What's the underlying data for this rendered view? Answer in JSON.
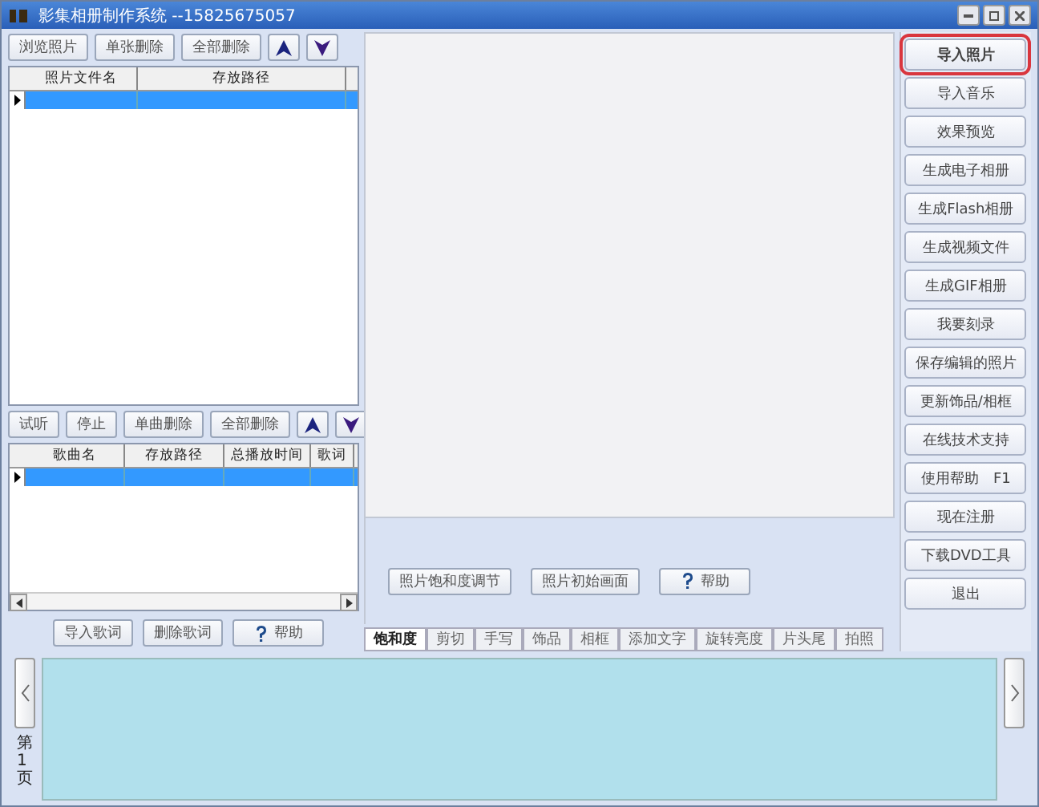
{
  "window": {
    "title": "影集相册制作系统 --15825675057"
  },
  "photo_toolbar": {
    "buttons": [
      "浏览照片",
      "单张删除",
      "全部删除"
    ]
  },
  "photo_table": {
    "columns": [
      "照片文件名",
      "存放路径"
    ],
    "rows": [
      {
        "selected": true
      }
    ]
  },
  "music_toolbar": {
    "buttons": [
      "试听",
      "停止",
      "单曲删除",
      "全部删除"
    ]
  },
  "music_table": {
    "columns": [
      "歌曲名",
      "存放路径",
      "总播放时间",
      "歌词"
    ],
    "rows": [
      {
        "selected": true
      }
    ]
  },
  "lyrics_buttons": [
    {
      "label": "导入歌词",
      "kind": "plain"
    },
    {
      "label": "删除歌词",
      "kind": "plain"
    },
    {
      "label": "帮助",
      "kind": "help"
    }
  ],
  "edit_buttons": [
    {
      "label": "照片饱和度调节",
      "kind": "plain"
    },
    {
      "label": "照片初始画面",
      "kind": "plain"
    },
    {
      "label": "帮助",
      "kind": "help"
    }
  ],
  "edit_tabs": [
    {
      "label": "饱和度",
      "selected": true
    },
    {
      "label": "剪切",
      "selected": false
    },
    {
      "label": "手写",
      "selected": false
    },
    {
      "label": "饰品",
      "selected": false
    },
    {
      "label": "相框",
      "selected": false
    },
    {
      "label": "添加文字",
      "selected": false
    },
    {
      "label": "旋转亮度",
      "selected": false
    },
    {
      "label": "片头尾",
      "selected": false
    },
    {
      "label": "拍照",
      "selected": false
    }
  ],
  "actions": [
    {
      "label": "导入照片",
      "selected": true
    },
    {
      "label": "导入音乐",
      "selected": false
    },
    {
      "label": "效果预览",
      "selected": false
    },
    {
      "label": "生成电子相册",
      "selected": false
    },
    {
      "label": "生成Flash相册",
      "selected": false
    },
    {
      "label": "生成视频文件",
      "selected": false
    },
    {
      "label": "生成GIF相册",
      "selected": false
    },
    {
      "label": "我要刻录",
      "selected": false
    },
    {
      "label": "保存编辑的照片",
      "selected": false
    },
    {
      "label": "更新饰品/相框",
      "selected": false
    },
    {
      "label": "在线技术支持",
      "selected": false
    },
    {
      "label": "使用帮助　F1",
      "selected": false
    },
    {
      "label": "现在注册",
      "selected": false
    },
    {
      "label": "下载DVD工具",
      "selected": false
    },
    {
      "label": "退出",
      "selected": false
    }
  ],
  "filmstrip": {
    "page_label": "第1页"
  }
}
